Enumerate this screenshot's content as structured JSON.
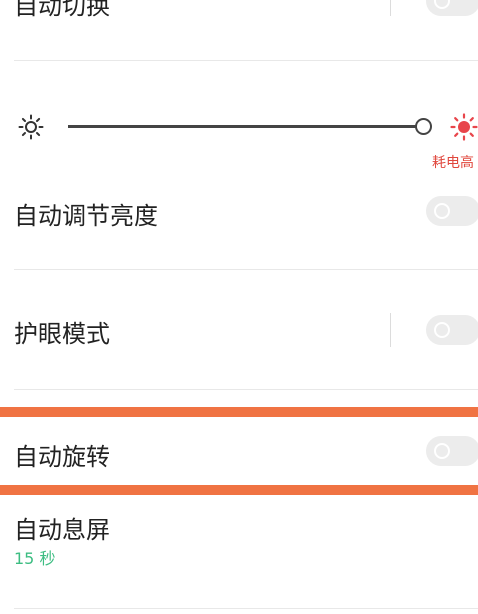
{
  "settings": {
    "auto_switch": {
      "label": "自动切换"
    },
    "brightness": {
      "level": 1.0,
      "high_power_hint": "耗电高",
      "low_icon": "sun-outline-icon",
      "high_icon": "sun-filled-icon",
      "high_icon_color": "#e8454b"
    },
    "auto_brightness": {
      "label": "自动调节亮度",
      "enabled": false
    },
    "eye_protection": {
      "label": "护眼模式",
      "enabled": false
    },
    "auto_rotate": {
      "label": "自动旋转",
      "enabled": false,
      "highlighted": true,
      "highlight_color": "#f07343"
    },
    "auto_sleep": {
      "label": "自动息屏",
      "value": "15 秒"
    }
  }
}
